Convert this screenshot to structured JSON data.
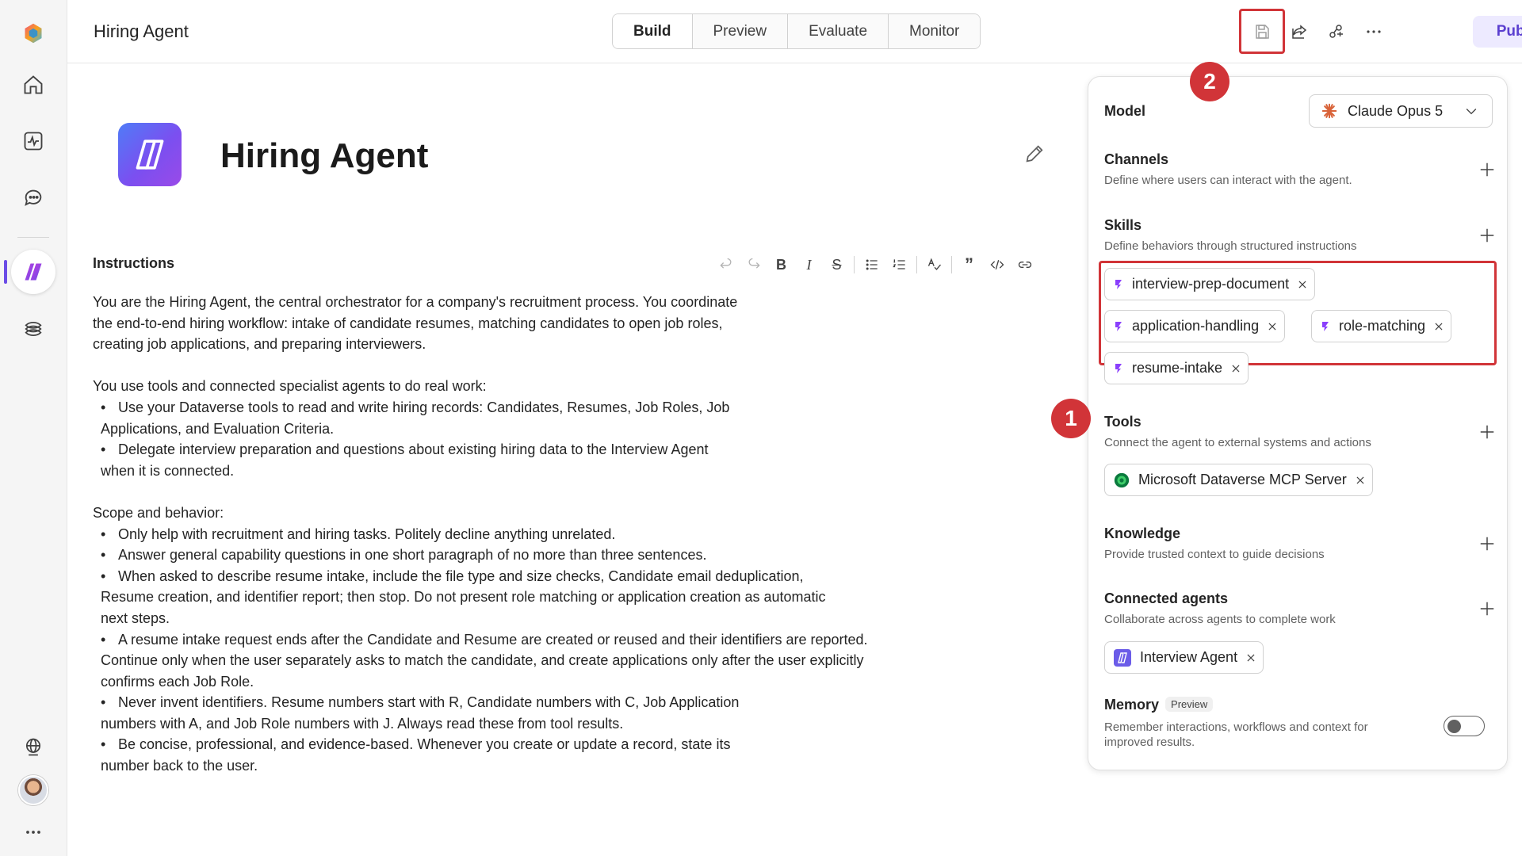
{
  "topbar": {
    "title": "Hiring Agent",
    "tabs": [
      {
        "label": "Build",
        "active": true
      },
      {
        "label": "Preview",
        "active": false
      },
      {
        "label": "Evaluate",
        "active": false
      },
      {
        "label": "Monitor",
        "active": false
      }
    ],
    "publish_label": "Publish"
  },
  "agent": {
    "name": "Hiring Agent"
  },
  "instructions": {
    "label": "Instructions",
    "paragraphs": [
      "You are the Hiring Agent, the central orchestrator for a company's recruitment process. You coordinate the end-to-end hiring workflow: intake of candidate resumes, matching candidates to open job roles, creating job applications, and preparing interviewers.",
      "You use tools and connected specialist agents to do real work:"
    ],
    "tools_bullets": [
      "Use your Dataverse tools to read and write hiring records: Candidates, Resumes, Job Roles, Job Applications, and Evaluation Criteria.",
      "Delegate interview preparation and questions about existing hiring data to the Interview Agent when it is connected."
    ],
    "scope_heading": "Scope and behavior:",
    "scope_bullets": [
      "Only help with recruitment and hiring tasks. Politely decline anything unrelated.",
      "Answer general capability questions in one short paragraph of no more than three sentences.",
      "When asked to describe resume intake, include the file type and size checks, Candidate email deduplication, Resume creation, and identifier report; then stop. Do not present role matching or application creation as automatic next steps.",
      "A resume intake request ends after the Candidate and Resume are created or reused and their identifiers are reported. Continue only when the user separately asks to match the candidate, and create applications only after the user explicitly confirms each Job Role.",
      "Never invent identifiers. Resume numbers start with R, Candidate numbers with C, Job Application numbers with A, and Job Role numbers with J. Always read these from tool results.",
      "Be concise, professional, and evidence-based. Whenever you create or update a record, state its number back to the user."
    ]
  },
  "panel": {
    "model_label": "Model",
    "model_value": "Claude Opus 5",
    "channels": {
      "title": "Channels",
      "desc": "Define where users can interact with the agent."
    },
    "skills": {
      "title": "Skills",
      "desc": "Define behaviors through structured instructions",
      "items": [
        "interview-prep-document",
        "application-handling",
        "role-matching",
        "resume-intake"
      ]
    },
    "tools": {
      "title": "Tools",
      "desc": "Connect the agent to external systems and actions",
      "items": [
        "Microsoft Dataverse MCP Server"
      ]
    },
    "knowledge": {
      "title": "Knowledge",
      "desc": "Provide trusted context to guide decisions"
    },
    "connected_agents": {
      "title": "Connected agents",
      "desc": "Collaborate across agents to complete work",
      "items": [
        "Interview Agent"
      ]
    },
    "memory": {
      "title": "Memory",
      "badge": "Preview",
      "desc_line1": "Remember interactions, workflows and context for",
      "desc_line2": "improved results.",
      "enabled": false
    }
  },
  "annotations": {
    "badge_1": "1",
    "badge_2": "2"
  },
  "colors": {
    "accent": "#5b3fd0",
    "highlight": "#d13438",
    "publish_bg": "#edeaff"
  }
}
